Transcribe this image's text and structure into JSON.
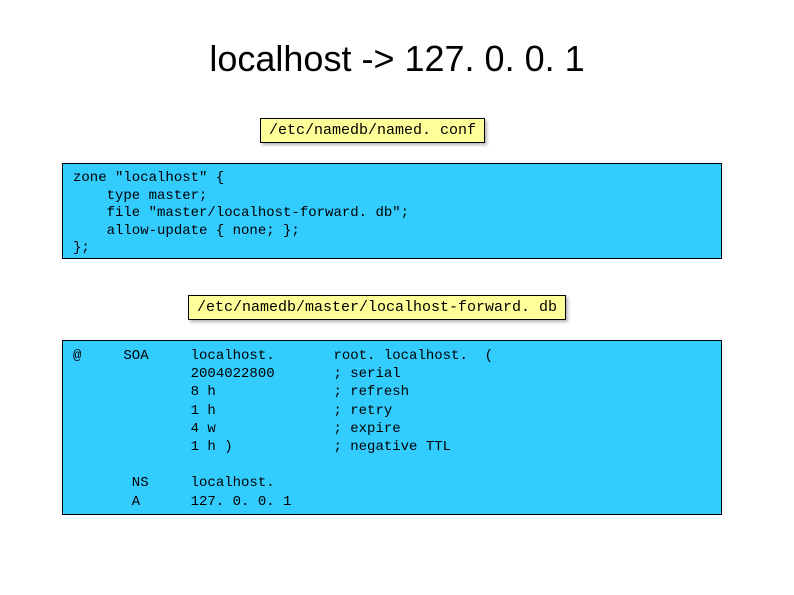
{
  "title": "localhost -> 127. 0. 0. 1",
  "file1_label": "/etc/namedb/named. conf",
  "code1": "zone \"localhost\" {\n    type master;\n    file \"master/localhost-forward. db\";\n    allow-update { none; };\n};",
  "file2_label": "/etc/namedb/master/localhost-forward. db",
  "code2": "@     SOA     localhost.       root. localhost.  (\n              2004022800       ; serial\n              8 h              ; refresh\n              1 h              ; retry\n              4 w              ; expire\n              1 h )            ; negative TTL\n\n       NS     localhost.\n       A      127. 0. 0. 1"
}
